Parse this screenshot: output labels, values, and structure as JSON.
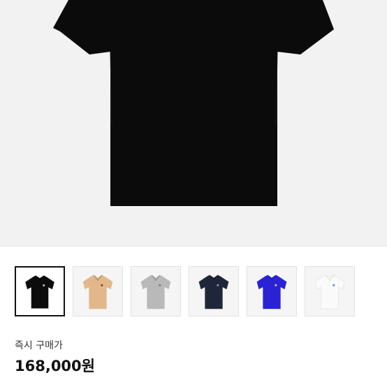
{
  "product": {
    "main_image": {
      "color": "#0b0b0c",
      "icon": "black-polo-shirt"
    },
    "swatches": [
      {
        "name": "black",
        "color": "#0c0c0d",
        "logo": "#c9c4b5",
        "selected": true
      },
      {
        "name": "beige",
        "color": "#e2b88a",
        "logo": "#6b4a2e",
        "selected": false
      },
      {
        "name": "grey",
        "color": "#b9b9b9",
        "logo": "#7d7d7d",
        "selected": false
      },
      {
        "name": "navy",
        "color": "#20263a",
        "logo": "#8c8f9a",
        "selected": false
      },
      {
        "name": "royal-blue",
        "color": "#2a23d6",
        "logo": "#d7c9a2",
        "selected": false
      },
      {
        "name": "white",
        "color": "#fafafa",
        "logo": "#6a8ad0",
        "selected": false
      }
    ]
  },
  "pricing": {
    "label": "즉시 구매가",
    "value": "168,000원"
  }
}
